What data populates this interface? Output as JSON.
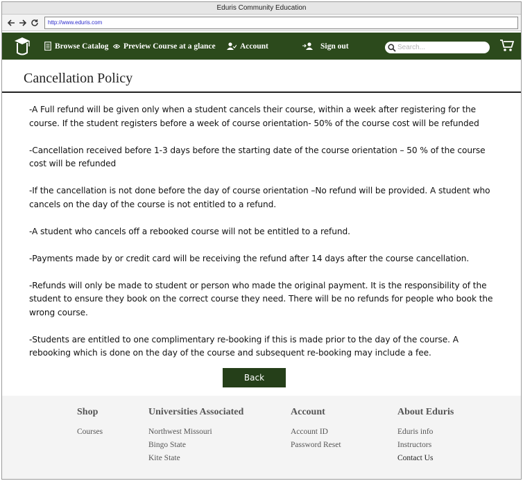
{
  "window": {
    "title": "Eduris Community Education"
  },
  "browser": {
    "url": "http://www.eduris.com"
  },
  "nav": {
    "items": [
      {
        "label": "Browse Catalog"
      },
      {
        "label": "Preview Course at a glance"
      },
      {
        "label": "Account"
      },
      {
        "label": "Sign out"
      }
    ],
    "search_placeholder": "Search..."
  },
  "page": {
    "title": "Cancellation Policy",
    "paragraphs": [
      "-A Full refund will be given only when a student cancels their course, within a week after registering for the course. If the student registers before a week of course orientation- 50% of the course cost will be refunded",
      "-Cancellation received before 1-3 days before the starting date of the course orientation – 50 % of the course cost will be refunded",
      "-If the cancellation is not done before the day of course orientation –No refund will be provided. A student who cancels on the day of the course is not entitled to a refund.",
      "-A student who cancels off a rebooked course will not be entitled to a refund.",
      "-Payments made by or credit card will be receiving the refund after 14 days after the course cancellation.",
      "-Refunds will only be made to student or person who made the original payment. It is the responsibility of the student to ensure they book on the correct course they need. There will be no refunds for people who book the wrong course.",
      "-Students are entitled to one complimentary re-booking if this is made prior to the day of the course. A rebooking which is done on the day of the course and subsequent re-booking may include a fee."
    ],
    "back_label": "Back"
  },
  "footer": {
    "shop": {
      "title": "Shop",
      "links": [
        "Courses"
      ]
    },
    "universities": {
      "title": "Universities Associated",
      "links": [
        "Northwest Missouri",
        "Bingo State",
        "Kite State"
      ]
    },
    "account": {
      "title": "Account",
      "links": [
        "Account ID",
        "Password Reset"
      ]
    },
    "about": {
      "title": "About Eduris",
      "links": [
        "Eduris info",
        "Instructors",
        "Contact Us"
      ]
    }
  },
  "colors": {
    "nav_bg": "#2c4a1c",
    "button_bg": "#253f19",
    "footer_bg": "#f4f4f4"
  }
}
